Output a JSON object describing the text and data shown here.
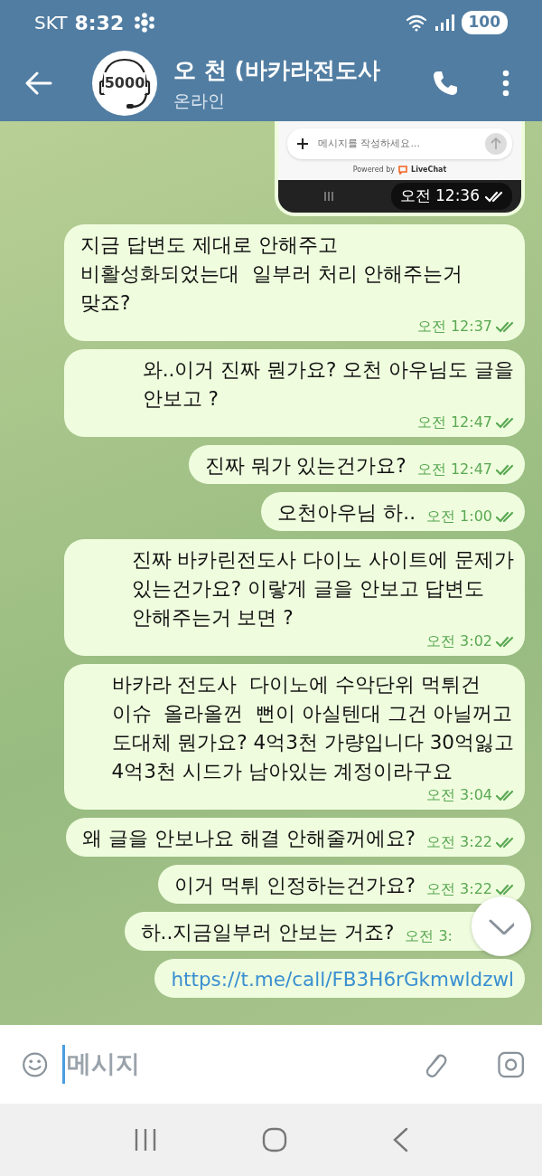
{
  "status_bar": {
    "carrier": "SKT",
    "time": "8:32",
    "battery": "100"
  },
  "header": {
    "title": "오 천 (바카라전도사",
    "subtitle": "온라인",
    "avatar_text": "5000"
  },
  "messages": [
    {
      "kind": "screenshot",
      "field_hint": "메시지를 작성하세요...",
      "powered_by": "Powered by",
      "brand": "LiveChat",
      "time": "오전 12:36",
      "read": true
    },
    {
      "kind": "text",
      "text": "지금 답변도 제대로 안해주고\n비활성화되었는대  일부러 처리 안해주는거 맞죠?",
      "time": "오전 12:37",
      "read": true
    },
    {
      "kind": "text",
      "text": "와..이거 진짜 뭔가요? 오천 아우님도 글을\n안보고 ?",
      "time": "오전 12:47",
      "read": true
    },
    {
      "kind": "text",
      "text": "진짜 뭐가 있는건가요?",
      "time": "오전 12:47",
      "read": true
    },
    {
      "kind": "text",
      "text": "오천아우님 하..",
      "time": "오전 1:00",
      "read": true
    },
    {
      "kind": "text",
      "text": "진짜 바카린전도사 다이노 사이트에 문제가\n있는건가요? 이랗게 글을 안보고 답변도\n안해주는거 보면 ?",
      "time": "오전 3:02",
      "read": true
    },
    {
      "kind": "text",
      "text": "바카라 전도사  다이노에 수악단위 먹튀건\n이슈  올라올껀  뻔이 아실텐대 그건 아닐꺼고\n도대체 뭔가요? 4억3천 가량입니다 30억잃고\n4억3천 시드가 남아있는 계정이라구요",
      "time": "오전 3:04",
      "read": true
    },
    {
      "kind": "text",
      "text": "왜 글을 안보나요 해결 안해줄꺼에요?",
      "time": "오전 3:22",
      "read": true
    },
    {
      "kind": "text",
      "text": "이거 먹튀 인정하는건가요?",
      "time": "오전 3:22",
      "read": true
    },
    {
      "kind": "text",
      "text": "하..지금일부러 안보는 거죠?",
      "time": "오전 3:"
    },
    {
      "kind": "link",
      "text": "https://t.me/call/FB3H6rGkmwldzwl"
    }
  ],
  "composer": {
    "placeholder": "메시지"
  }
}
